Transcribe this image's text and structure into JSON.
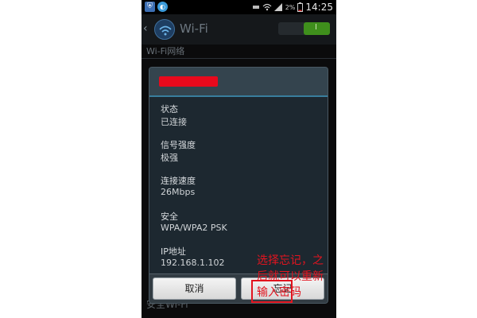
{
  "status_bar": {
    "app_icons": [
      "shield-app-icon",
      "circle-app-icon"
    ],
    "net_speed": "3.9K/s",
    "battery_percent": "2%",
    "time": "14:25"
  },
  "action_bar": {
    "title": "Wi-Fi",
    "toggle_label": "I"
  },
  "background": {
    "section_header": "Wi-Fi网络",
    "bottom_item": "安全Wi-Fi"
  },
  "dialog": {
    "title_redacted": true,
    "rows": [
      {
        "label": "状态",
        "value": "已连接"
      },
      {
        "label": "信号强度",
        "value": "极强"
      },
      {
        "label": "连接速度",
        "value": "26Mbps"
      },
      {
        "label": "安全",
        "value": "WPA/WPA2 PSK"
      },
      {
        "label": "IP地址",
        "value": "192.168.1.102"
      }
    ],
    "cancel_label": "取消",
    "forget_label": "忘记"
  },
  "annotation": {
    "line1": "选择忘记，之",
    "line2": "后就可以重新",
    "line3": "输入密码"
  },
  "colors": {
    "accent_red": "#e2141f",
    "toggle_on": "#3f8f1c",
    "dialog_bg": "#1d2830"
  }
}
